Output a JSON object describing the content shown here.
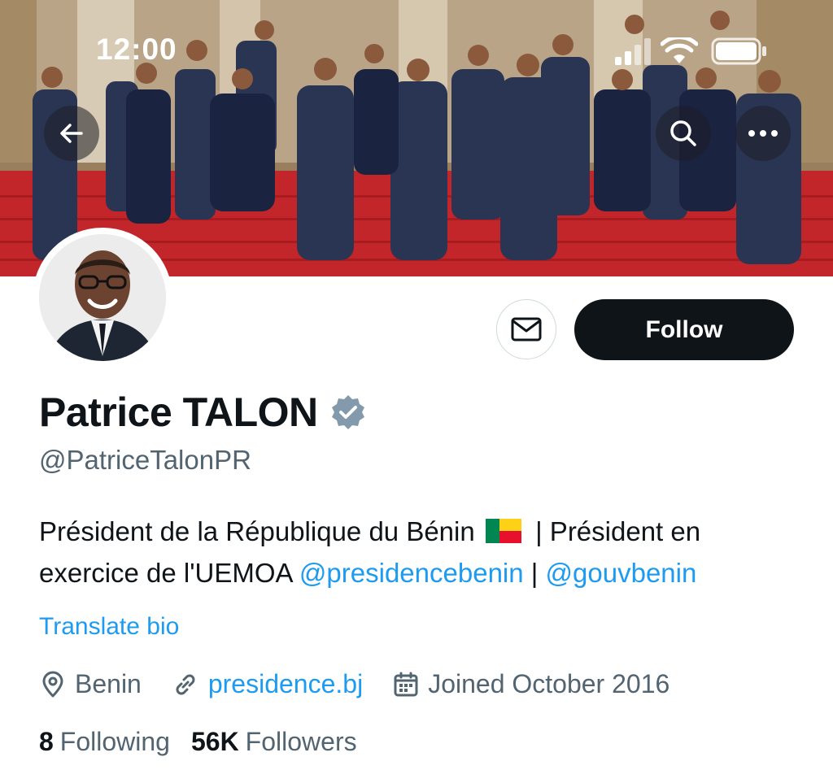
{
  "status_bar": {
    "time": "12:00"
  },
  "header": {
    "image": "cabinet-group-photo-red-carpet"
  },
  "profile": {
    "name": "Patrice TALON",
    "handle": "@PatriceTalonPR",
    "verified": true,
    "bio": {
      "text_1": "Président de la République du Bénin",
      "flag": "benin-flag",
      "text_2": "| Président en exercice de l'UEMOA",
      "mention_1": "@presidencebenin",
      "separator": "|",
      "mention_2": "@gouvbenin"
    },
    "translate_label": "Translate bio",
    "location": "Benin",
    "website": "presidence.bj",
    "joined": "Joined October 2016",
    "following_count": "8",
    "following_label": "Following",
    "followers_count": "56K",
    "followers_label": "Followers"
  },
  "actions": {
    "follow_label": "Follow",
    "message_icon": "mail-icon"
  },
  "colors": {
    "link": "#1d9bf0",
    "text": "#0f1419",
    "secondary": "#536471",
    "carpet": "#c62a2a",
    "verified_badge": "#829aab"
  }
}
